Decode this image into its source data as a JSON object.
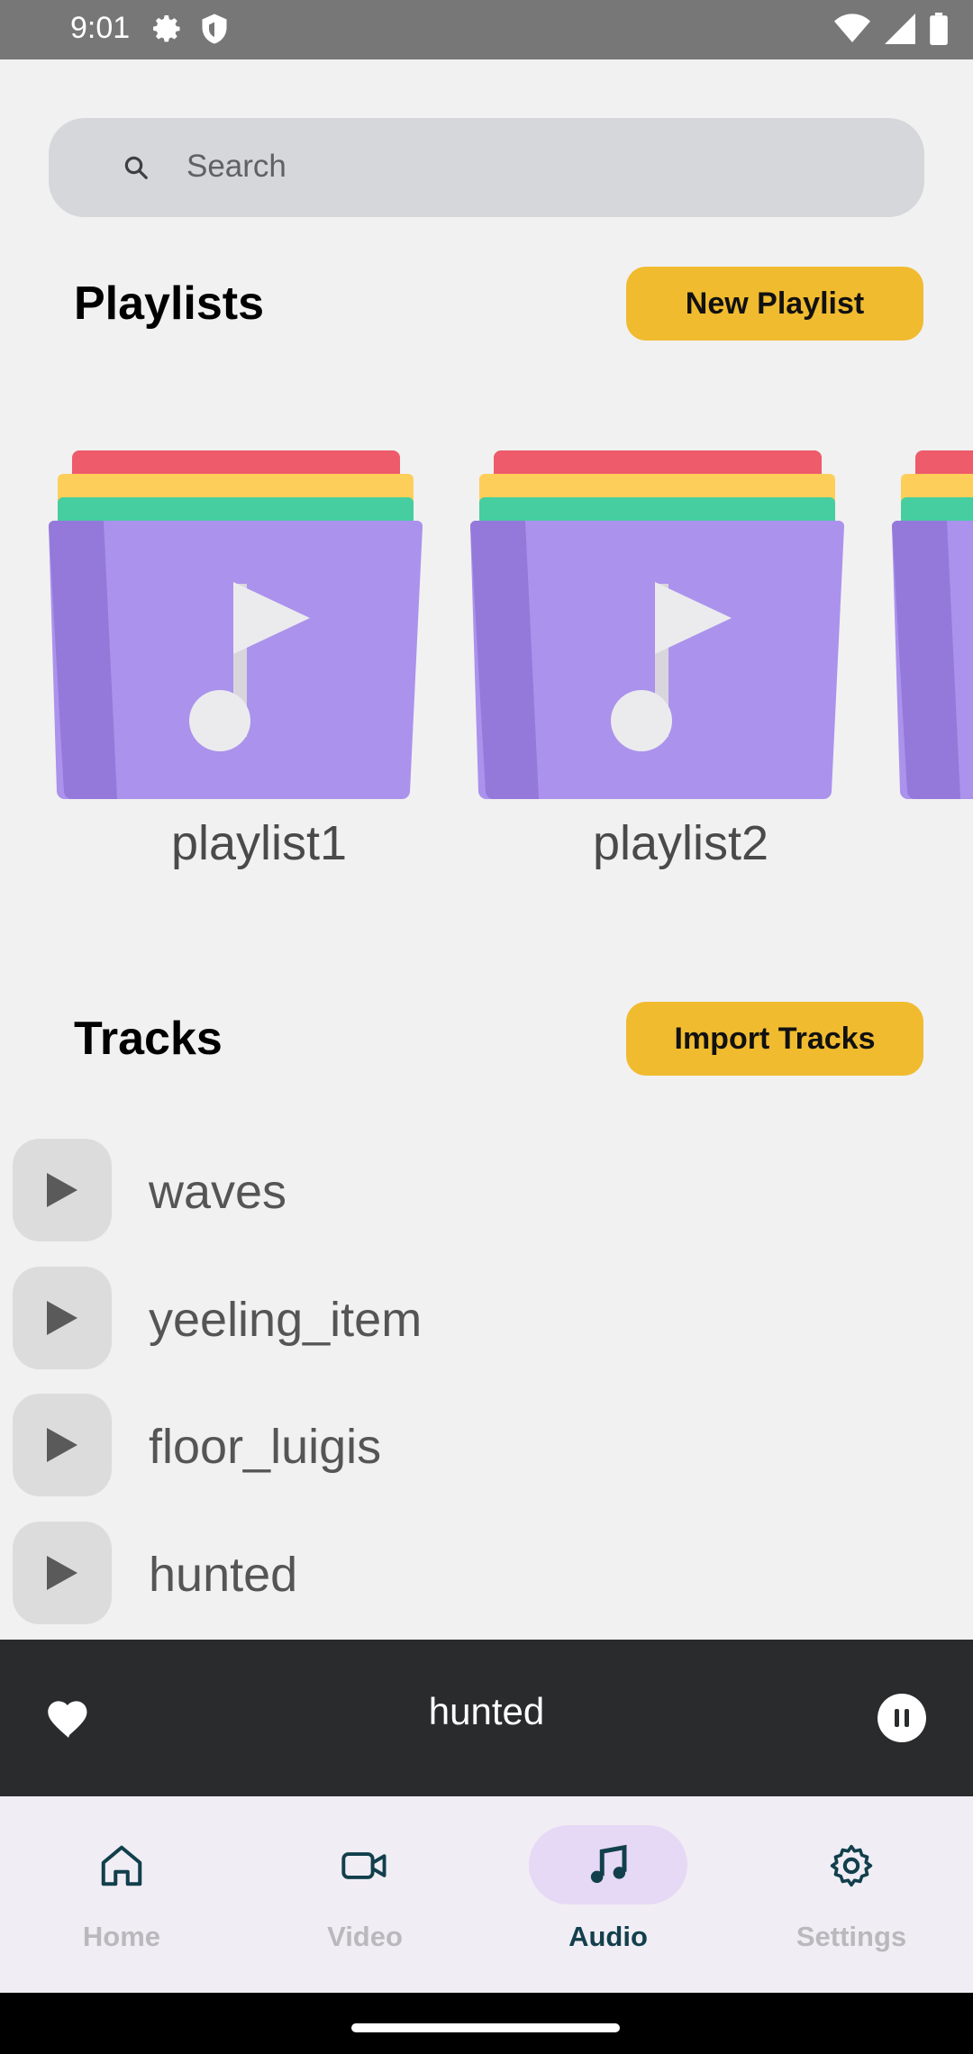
{
  "status_bar": {
    "time": "9:01"
  },
  "search": {
    "placeholder": "Search"
  },
  "playlists": {
    "title": "Playlists",
    "new_button": "New Playlist",
    "items": [
      {
        "name": "playlist1"
      },
      {
        "name": "playlist2"
      }
    ]
  },
  "tracks": {
    "title": "Tracks",
    "import_button": "Import Tracks",
    "items": [
      {
        "name": "waves"
      },
      {
        "name": "yeeling_item"
      },
      {
        "name": "floor_luigis"
      },
      {
        "name": "hunted"
      }
    ]
  },
  "player": {
    "current_track": "hunted",
    "state": "playing"
  },
  "nav": {
    "items": [
      {
        "label": "Home",
        "icon": "home-icon"
      },
      {
        "label": "Video",
        "icon": "video-icon"
      },
      {
        "label": "Audio",
        "icon": "music-note-icon",
        "active": true
      },
      {
        "label": "Settings",
        "icon": "gear-icon"
      }
    ]
  },
  "colors": {
    "accent_yellow": "#f0bb2f",
    "folder_purple": "#ab92ec",
    "active_nav": "#123f4c",
    "player_bg": "#2a2b2d"
  }
}
